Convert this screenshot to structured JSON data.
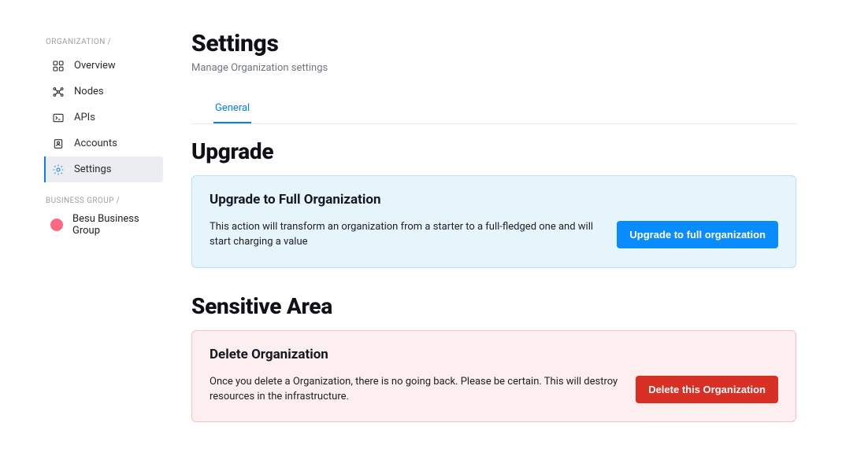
{
  "sidebar": {
    "sections": {
      "organization": {
        "label": "ORGANIZATION /",
        "items": [
          {
            "label": "Overview"
          },
          {
            "label": "Nodes"
          },
          {
            "label": "APIs"
          },
          {
            "label": "Accounts"
          },
          {
            "label": "Settings"
          }
        ]
      },
      "business_group": {
        "label": "BUSINESS GROUP /",
        "items": [
          {
            "label": "Besu Business Group"
          }
        ]
      }
    }
  },
  "page": {
    "title": "Settings",
    "subtitle": "Manage Organization settings"
  },
  "tabs": [
    {
      "label": "General"
    }
  ],
  "sections": {
    "upgrade": {
      "heading": "Upgrade",
      "panel_title": "Upgrade to Full Organization",
      "panel_text": "This action will transform an organization from a starter to a full-fledged one and will start charging a value",
      "button": "Upgrade to full organization"
    },
    "sensitive": {
      "heading": "Sensitive Area",
      "panel_title": "Delete Organization",
      "panel_text": "Once you delete a Organization, there is no going back. Please be certain. This will destroy resources in the infrastructure.",
      "button": "Delete this Organization"
    }
  },
  "colors": {
    "accent": "#0a7cff",
    "danger": "#d93025",
    "panel_blue_bg": "#e6f5fb",
    "panel_red_bg": "#fdeff0"
  }
}
